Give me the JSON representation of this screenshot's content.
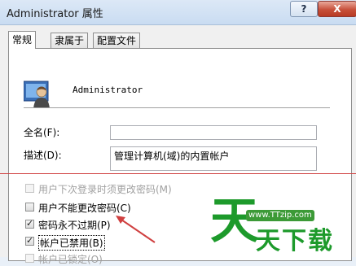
{
  "window": {
    "title": "Administrator 属性",
    "help_label": "?",
    "close_label": "X"
  },
  "tabs": [
    {
      "label": "常规",
      "active": true
    },
    {
      "label": "隶属于",
      "active": false
    },
    {
      "label": "配置文件",
      "active": false
    }
  ],
  "user": {
    "name": "Administrator",
    "icon": "user-icon"
  },
  "fields": {
    "fullname": {
      "label": "全名(F):",
      "value": ""
    },
    "description": {
      "label": "描述(D):",
      "value": "管理计算机(域)的内置帐户"
    }
  },
  "checkboxes": [
    {
      "label": "用户下次登录时须更改密码(M)",
      "checked": false,
      "disabled": true
    },
    {
      "label": "用户不能更改密码(C)",
      "checked": false,
      "disabled": false
    },
    {
      "label": "密码永不过期(P)",
      "checked": true,
      "disabled": false
    },
    {
      "label": "帐户已禁用(B)",
      "checked": true,
      "disabled": false
    },
    {
      "label": "帐户已锁定(O)",
      "checked": false,
      "disabled": true
    }
  ],
  "watermark": {
    "url": "www.TTzip.com",
    "big": "天",
    "small": "天下载"
  },
  "colors": {
    "annotation_red": "#d04040",
    "watermark_green": "#1d9a2b"
  }
}
